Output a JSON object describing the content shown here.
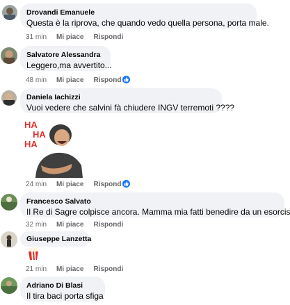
{
  "comments": [
    {
      "author": "Drovandi Emanuele",
      "text": "Questa è la riprova, che quando vedo quella persona, porta male.",
      "time": "31 min",
      "like_label": "Mi piace",
      "reply_label": "Rispondi"
    },
    {
      "author": "Salvatore Alessandra",
      "text": "Leggero,ma avvertito...",
      "time": "48 min",
      "like_label": "Mi piace",
      "reply_label": "Rispondi"
    },
    {
      "author": "Daniela Iachizzi",
      "text": "Vuoi vedere che salvini fà chiudere INGV terremoti ????",
      "time": "24 min",
      "like_label": "Mi piace",
      "reply_label": "Rispondi",
      "sticker_text": "HA HA HA"
    },
    {
      "author": "Francesco Salvato",
      "text": "Il Re di Sagre colpisce ancora. Mamma mia fatti benedire da un esorcista.",
      "time": "32 min",
      "like_label": "Mi piace",
      "reply_label": "Rispondi"
    },
    {
      "author": "Giuseppe Lanzetta",
      "text": "",
      "time": "21 min",
      "like_label": "Mi piace",
      "reply_label": "Rispondi"
    },
    {
      "author": "Adriano Di Blasi",
      "text": "Il tira baci porta sfiga"
    }
  ],
  "colors": {
    "bubble": "#f0f2f5",
    "meta_text": "#65676b",
    "like_blue": "#1877f2"
  },
  "icons": {
    "reaction": "like-thumb-icon",
    "popcorn": "popcorn-emoji-icon"
  }
}
